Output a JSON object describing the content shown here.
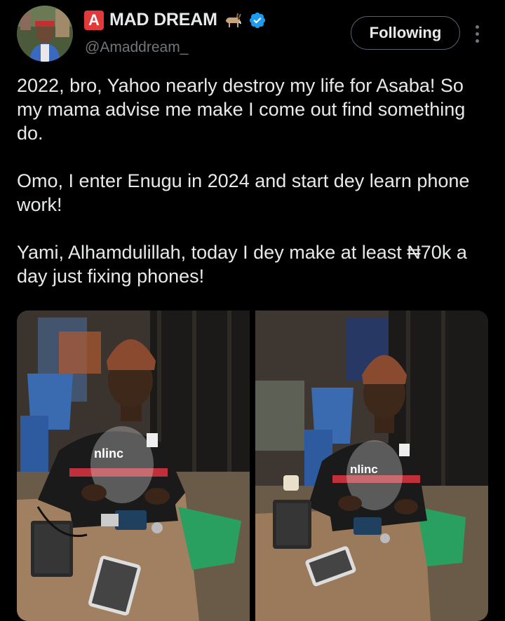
{
  "author": {
    "badge_letter": "A",
    "display_name": "MAD DREAM",
    "emoji_icon": "goat-icon",
    "verified": true,
    "handle": "@Amaddream_"
  },
  "actions": {
    "follow_label": "Following",
    "more_icon": "more-vertical-icon"
  },
  "tweet": {
    "paragraphs": [
      "2022, bro, Yahoo nearly destroy my life for Asaba! So my mama advise me make I come out find something do.",
      "Omo, I enter Enugu in 2024 and start dey learn phone work!",
      "Yami, Alhamdulillah, today I dey make at least ₦70k a day just fixing phones!"
    ]
  },
  "media": {
    "count": 2,
    "shirt_text": "nlinc"
  },
  "colors": {
    "background": "#000000",
    "text": "#e7e9ea",
    "secondary": "#71767b",
    "verified": "#1d9bf0",
    "badge": "#e23a3a"
  }
}
